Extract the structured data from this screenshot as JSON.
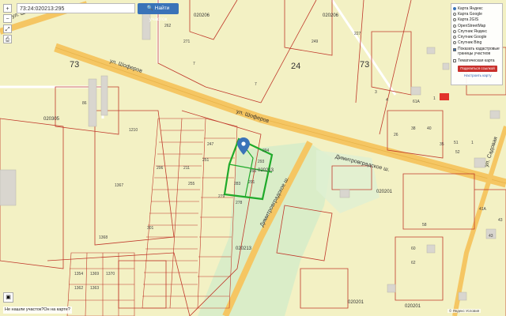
{
  "search": {
    "value": "73:24:020213:295",
    "button_label": "Найти участок"
  },
  "map_controls": {
    "zoom_in": "+",
    "zoom_out": "−",
    "fullscreen": "⤢",
    "print": "⎙"
  },
  "layers": {
    "options": [
      {
        "label": "Карта Яндекс",
        "selected": true
      },
      {
        "label": "Карта Google",
        "selected": false
      },
      {
        "label": "Карта 2GIS",
        "selected": false
      },
      {
        "label": "OpenStreetMap",
        "selected": false
      },
      {
        "label": "Спутник Яндекс",
        "selected": false
      },
      {
        "label": "Спутник Google",
        "selected": false
      },
      {
        "label": "Спутник Bing",
        "selected": false
      }
    ],
    "checkboxes": [
      {
        "label": "Показать кадастровые границы участков",
        "checked": true
      },
      {
        "label": "Тематическая карта",
        "checked": false
      }
    ],
    "share_button": "Поделиться ссылкой",
    "setup_link": "Настроить карту"
  },
  "footer": {
    "help_link": "Не нашли участок?Он на карте?",
    "attribution": "© Яндекс Условия"
  },
  "labels": {
    "street_shofer_top": "ул. Шоферов",
    "street_shofer_mid": "ул. Шоферов",
    "street_shofer_right": "ул. Шоферов",
    "street_dimitrovgrad_right": "Димитровградское ш.",
    "street_dimitrovgrad_vert": "Димитровградское ш.",
    "street_sadovaya": "ул. Садовая",
    "quarter_73_left": "73",
    "quarter_24": "24",
    "quarter_73_right": "73",
    "cad_020206_top": "020206",
    "cad_020206_right": "020206",
    "cad_020305": "020305",
    "cad_020213_a": "020213",
    "cad_020213_b": "020213",
    "cad_020201_a": "020201",
    "cad_020201_b": "020201",
    "cad_020201_c": "020201",
    "plots": [
      "271",
      "7",
      "262",
      "249",
      "227",
      "7",
      "1210",
      "86",
      "301",
      "206",
      "211",
      "1367",
      "1368",
      "1354",
      "1362",
      "1369",
      "1370",
      "1363",
      "294",
      "293",
      "290",
      "291",
      "283",
      "279",
      "278",
      "255",
      "251",
      "247",
      "1",
      "1",
      "52",
      "41A",
      "43",
      "58",
      "60",
      "62",
      "43",
      "51",
      "61A",
      "38",
      "40",
      "35",
      "26",
      "3",
      "4"
    ]
  }
}
